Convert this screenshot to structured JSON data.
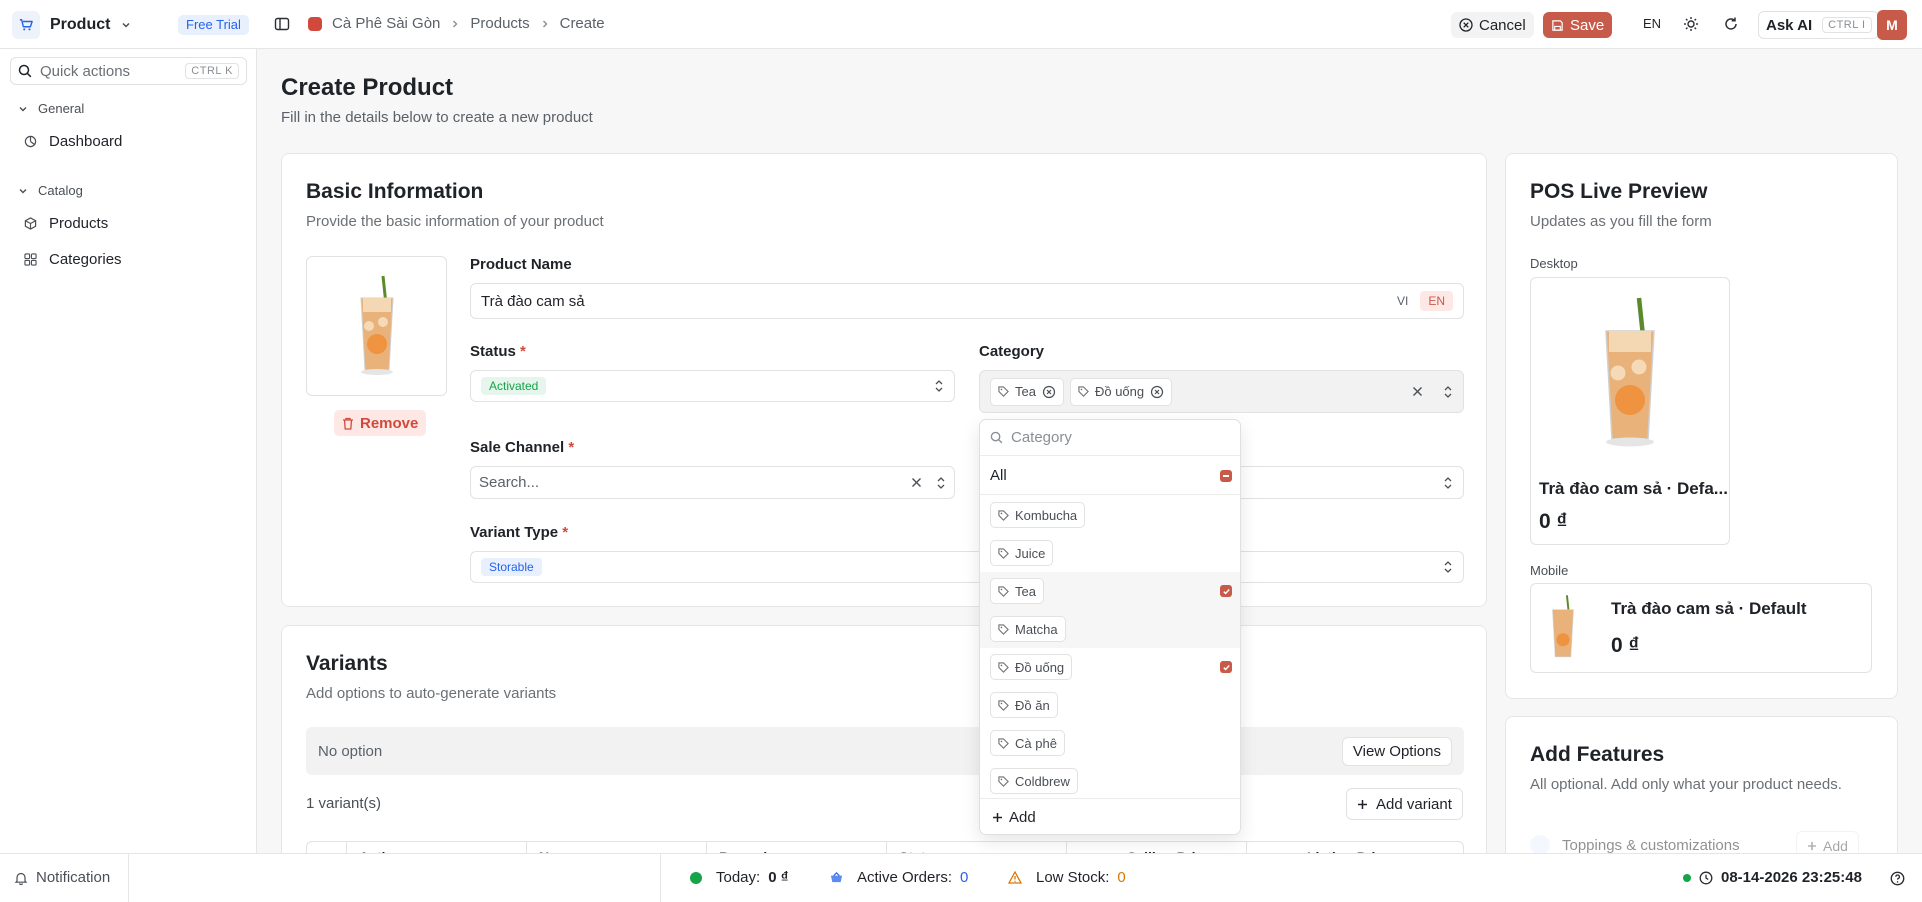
{
  "topbar": {
    "app_name": "Product",
    "trial_badge": "Free Trial",
    "breadcrumbs": [
      "Cà Phê Sài Gòn",
      "Products",
      "Create"
    ],
    "cancel_label": "Cancel",
    "save_label": "Save",
    "language": "EN",
    "ask_ai_label": "Ask AI",
    "ask_ai_shortcut": "CTRL I",
    "avatar_initial": "M"
  },
  "sidebar": {
    "quick_actions": "Quick actions",
    "quick_shortcut": "CTRL K",
    "groups": [
      {
        "label": "General",
        "items": [
          {
            "label": "Dashboard",
            "icon": "dashboard-icon"
          }
        ]
      },
      {
        "label": "Catalog",
        "items": [
          {
            "label": "Products",
            "icon": "box-icon"
          },
          {
            "label": "Categories",
            "icon": "grid-icon"
          }
        ]
      }
    ],
    "notification": "Notification"
  },
  "page": {
    "title": "Create Product",
    "subtitle": "Fill in the details below to create a new product"
  },
  "basic_info": {
    "title": "Basic Information",
    "subtitle": "Provide the basic information of your product",
    "remove_label": "Remove",
    "product_name_label": "Product Name",
    "product_name_value": "Trà đào cam sả",
    "lang_vi": "VI",
    "lang_en": "EN",
    "status_label": "Status",
    "status_value": "Activated",
    "category_label": "Category",
    "category_selected": [
      "Tea",
      "Đồ uống"
    ],
    "sale_channel_label": "Sale Channel",
    "sale_channel_placeholder": "Search...",
    "variant_type_label": "Variant Type",
    "variant_type_value": "Storable",
    "required_mark": "*"
  },
  "category_dropdown": {
    "search_placeholder": "Category",
    "all_label": "All",
    "options": [
      {
        "label": "Kombucha",
        "checked": false
      },
      {
        "label": "Juice",
        "checked": false
      },
      {
        "label": "Tea",
        "checked": true
      },
      {
        "label": "Matcha",
        "checked": false
      },
      {
        "label": "Đồ uống",
        "checked": true
      },
      {
        "label": "Đồ ăn",
        "checked": false
      },
      {
        "label": "Cà phê",
        "checked": false
      },
      {
        "label": "Coldbrew",
        "checked": false
      }
    ],
    "add_label": "Add"
  },
  "variants": {
    "title": "Variants",
    "subtitle": "Add options to auto-generate variants",
    "no_option": "No option",
    "view_options": "View Options",
    "count": "1 variant(s)",
    "add_variant": "Add variant",
    "columns": [
      "Actions",
      "Name",
      "Barcode",
      "Status",
      "Selling Price",
      "Listing Price"
    ]
  },
  "preview": {
    "title": "POS Live Preview",
    "subtitle": "Updates as you fill the form",
    "desktop_label": "Desktop",
    "desktop_name": "Trà đào cam sả · Defa...",
    "desktop_price": "0 ₫",
    "mobile_label": "Mobile",
    "mobile_name": "Trà đào cam sả · Default",
    "mobile_price": "0 ₫"
  },
  "features": {
    "title": "Add Features",
    "subtitle": "All optional. Add only what your product needs.",
    "first_feature": "Toppings & customizations",
    "add_label": "Add"
  },
  "statusbar": {
    "today_label": "Today:",
    "today_value": "0 ₫",
    "orders_label": "Active Orders:",
    "orders_value": "0",
    "lowstock_label": "Low Stock:",
    "lowstock_value": "0",
    "datetime": "08-14-2026 23:25:48"
  },
  "colors": {
    "accent": "#c85a4a",
    "status_green": "#16a34a",
    "link_blue": "#2563eb",
    "warning": "#d97706"
  }
}
